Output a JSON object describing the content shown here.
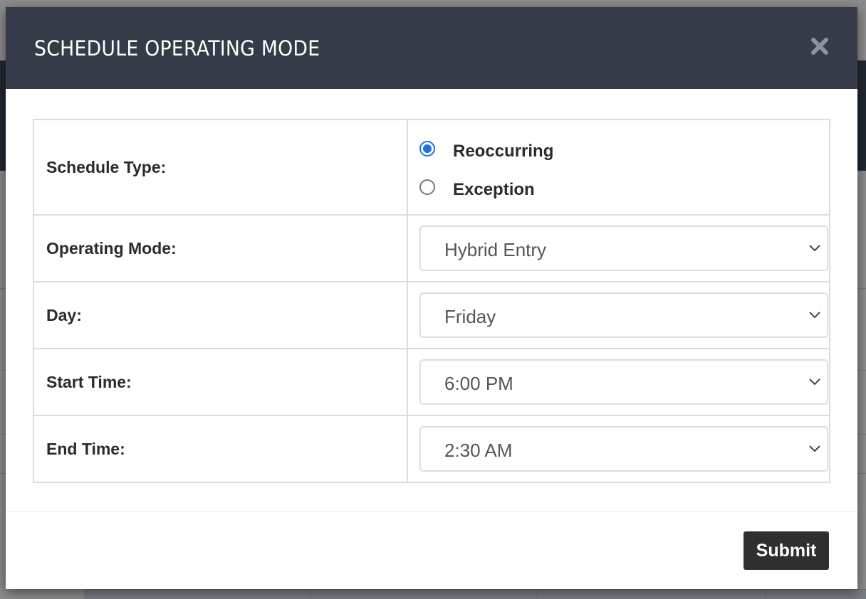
{
  "modal": {
    "title": "SCHEDULE OPERATING MODE",
    "close_icon": "close-x-icon"
  },
  "form": {
    "schedule_type": {
      "label": "Schedule Type:",
      "options": [
        {
          "label": "Reoccurring",
          "checked": true
        },
        {
          "label": "Exception",
          "checked": false
        }
      ]
    },
    "operating_mode": {
      "label": "Operating Mode:",
      "value": "Hybrid Entry"
    },
    "day": {
      "label": "Day:",
      "value": "Friday"
    },
    "start_time": {
      "label": "Start Time:",
      "value": "6:00 PM"
    },
    "end_time": {
      "label": "End Time:",
      "value": "2:30 AM"
    }
  },
  "footer": {
    "submit_label": "Submit"
  },
  "colors": {
    "header_bg": "#353b48",
    "radio_accent": "#1a73e8",
    "submit_bg": "#2f2f2f"
  }
}
